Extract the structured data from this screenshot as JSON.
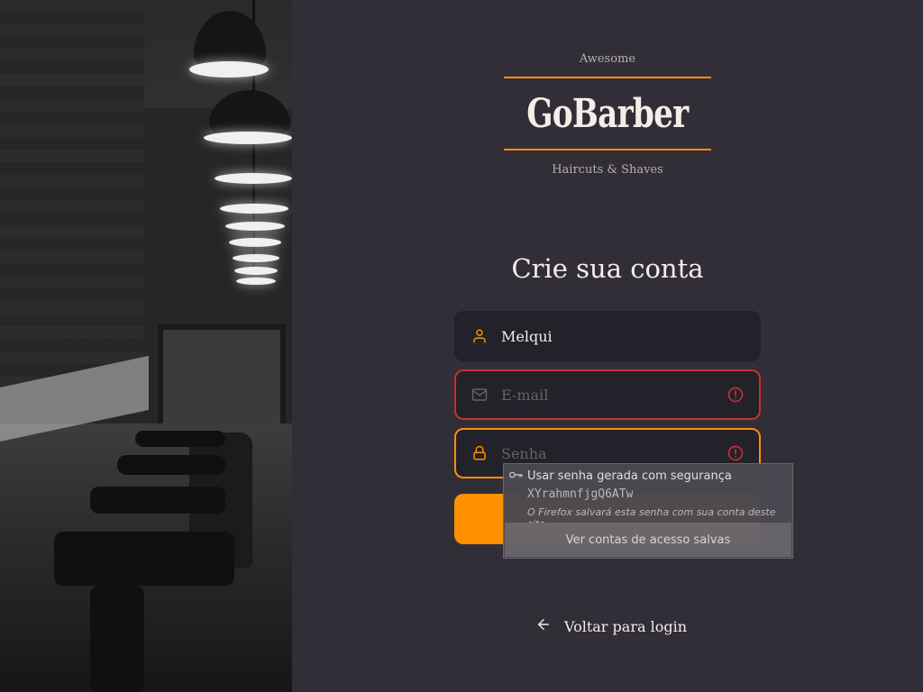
{
  "brand": {
    "top_text": "Awesome",
    "name": "GoBarber",
    "tagline": "Haircuts & Shaves"
  },
  "form": {
    "title": "Crie sua conta",
    "name_value": "Melqui",
    "email_placeholder": "E-mail",
    "password_placeholder": "Senha"
  },
  "back_link": "Voltar para login",
  "password_popup": {
    "use_label": "Usar senha gerada com segurança",
    "generated": "XYrahmnfjgQ6ATw",
    "note": "O Firefox salvará esta senha com sua conta deste site.",
    "saved_logins": "Ver contas de acesso salvas"
  },
  "colors": {
    "background": "#312e38",
    "input_bg": "#232129",
    "accent": "#ff9000",
    "error": "#c53030",
    "text": "#f4ede8"
  },
  "icons": [
    "user-icon",
    "mail-icon",
    "lock-icon",
    "alert-circle-icon",
    "arrow-left-icon",
    "key-icon"
  ]
}
